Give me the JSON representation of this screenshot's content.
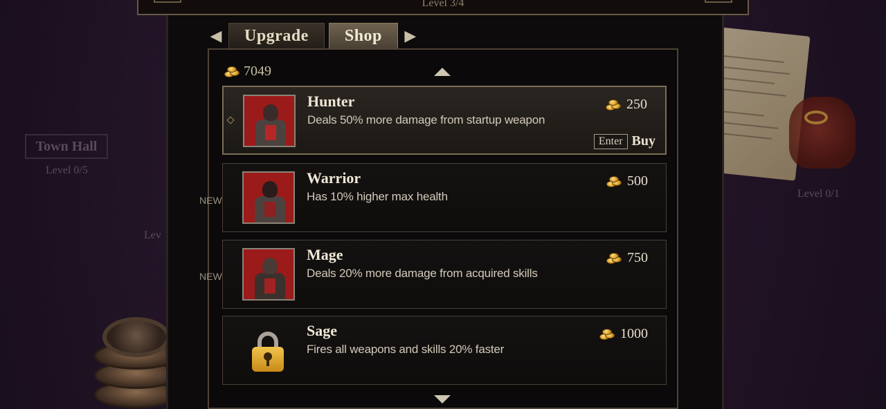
{
  "header": {
    "level": "Level 3/4"
  },
  "tabs": {
    "items": [
      {
        "label": "Upgrade",
        "active": false
      },
      {
        "label": "Shop",
        "active": true
      }
    ]
  },
  "gold": {
    "total": "7049"
  },
  "shop": {
    "items": [
      {
        "name": "Hunter",
        "description": "Deals 50% more damage from startup weapon",
        "price": "250",
        "new": "",
        "selected": true,
        "locked": false
      },
      {
        "name": "Warrior",
        "description": "Has 10% higher max health",
        "price": "500",
        "new": "NEW",
        "selected": false,
        "locked": false
      },
      {
        "name": "Mage",
        "description": "Deals 20% more damage from acquired skills",
        "price": "750",
        "new": "NEW",
        "selected": false,
        "locked": false
      },
      {
        "name": "Sage",
        "description": "Fires all weapons and skills 20% faster",
        "price": "1000",
        "new": "",
        "selected": false,
        "locked": true
      }
    ],
    "buy_key": "Enter",
    "buy_label": "Buy"
  },
  "background": {
    "town_hall_label": "Town Hall",
    "town_hall_level": "Level 0/5",
    "right_level": "Level 0/1",
    "left_partial": "Lev"
  },
  "colors": {
    "panel_bg": "#0d0b0b",
    "border": "#4e4336",
    "accent_gold": "#d49a22",
    "portrait_red": "#9b1a1a"
  }
}
